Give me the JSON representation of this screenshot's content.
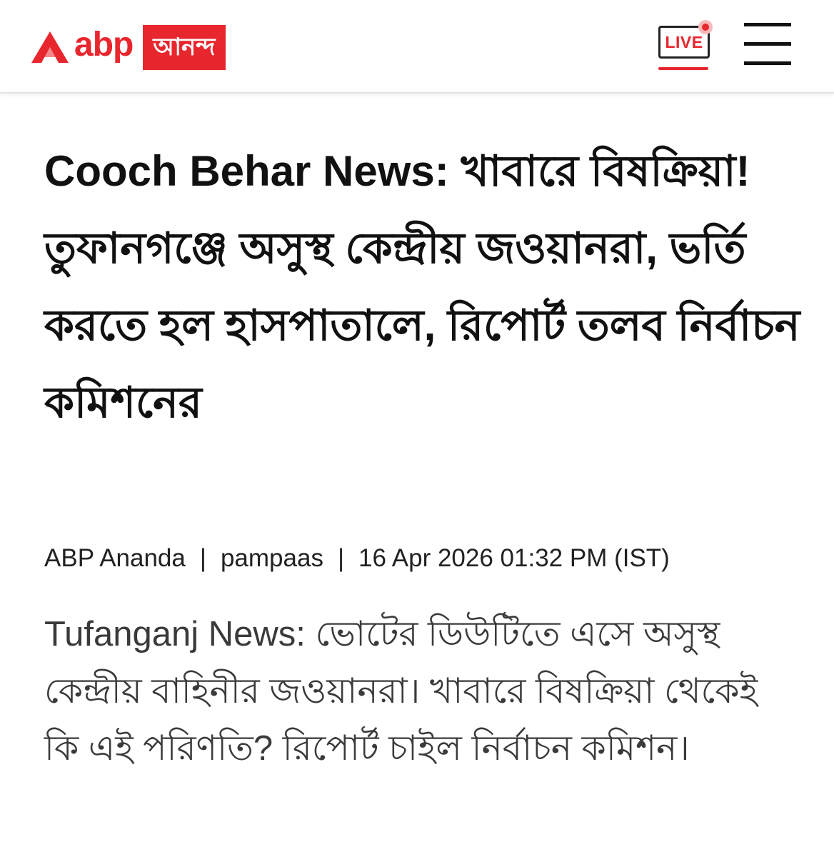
{
  "header": {
    "brand_abp": "abp",
    "brand_ananda": "আনন্দ",
    "live_label": "LIVE",
    "brand_color": "#e8262e"
  },
  "article": {
    "headline": "Cooch Behar News: খাবারে বিষক্রিয়া! তুফানগঞ্জে অসুস্থ কেন্দ্রীয় জওয়ানরা, ভর্তি করতে হল হাসপাতালে, রিপোর্ট তলব নির্বাচন কমিশনের",
    "source": "ABP Ananda",
    "separator": "|",
    "author": "pampaas",
    "timestamp": "16 Apr 2026 01:32 PM (IST)",
    "summary": "Tufanganj News: ভোটের ডিউটিতে এসে অসুস্থ কেন্দ্রীয় বাহিনীর জওয়ানরা। খাবারে বিষক্রিয়া থেকেই কি এই পরিণতি? রিপোর্ট চাইল নির্বাচন কমিশন।"
  },
  "icons": {
    "logo": "abp-triangle-logo-icon",
    "live": "live-tv-icon",
    "menu": "hamburger-menu-icon"
  }
}
